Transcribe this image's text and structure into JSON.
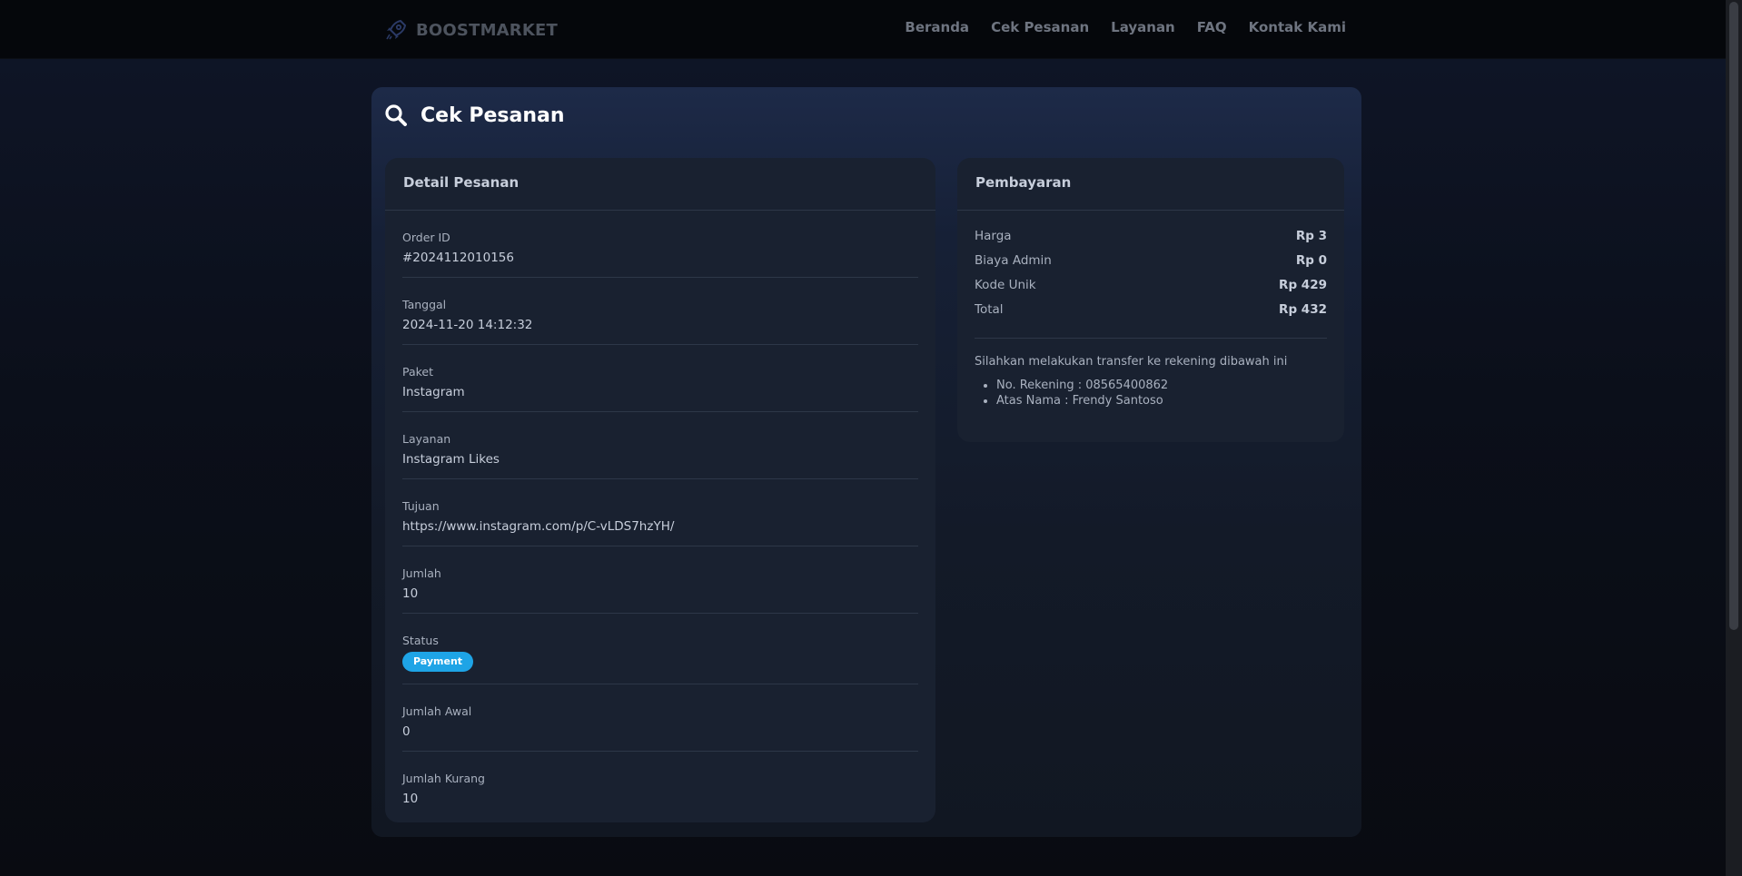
{
  "brand": {
    "name": "BOOSTMARKET",
    "icon": "rocket-icon"
  },
  "nav": [
    {
      "label": "Beranda"
    },
    {
      "label": "Cek Pesanan"
    },
    {
      "label": "Layanan"
    },
    {
      "label": "FAQ"
    },
    {
      "label": "Kontak Kami"
    }
  ],
  "page": {
    "title": "Cek Pesanan",
    "icon": "search-icon"
  },
  "detail": {
    "title": "Detail Pesanan",
    "rows": [
      {
        "label": "Order ID",
        "value": "#2024112010156"
      },
      {
        "label": "Tanggal",
        "value": "2024-11-20 14:12:32"
      },
      {
        "label": "Paket",
        "value": "Instagram"
      },
      {
        "label": "Layanan",
        "value": "Instagram Likes"
      },
      {
        "label": "Tujuan",
        "value": "https://www.instagram.com/p/C-vLDS7hzYH/"
      },
      {
        "label": "Jumlah",
        "value": "10"
      },
      {
        "label": "Status",
        "value": "Payment"
      },
      {
        "label": "Jumlah Awal",
        "value": "0"
      },
      {
        "label": "Jumlah Kurang",
        "value": "10"
      }
    ]
  },
  "payment": {
    "title": "Pembayaran",
    "fees": [
      {
        "label": "Harga",
        "value": "Rp 3"
      },
      {
        "label": "Biaya Admin",
        "value": "Rp 0"
      },
      {
        "label": "Kode Unik",
        "value": "Rp 429"
      },
      {
        "label": "Total",
        "value": "Rp 432"
      }
    ],
    "note": "Silahkan melakukan transfer ke rekening dibawah ini",
    "account": [
      "No. Rekening : 08565400862",
      "Atas Nama : Frendy Santoso"
    ]
  },
  "colors": {
    "accent": "#1ea4e6",
    "background": "#0a0c12",
    "panel": "#192130"
  }
}
